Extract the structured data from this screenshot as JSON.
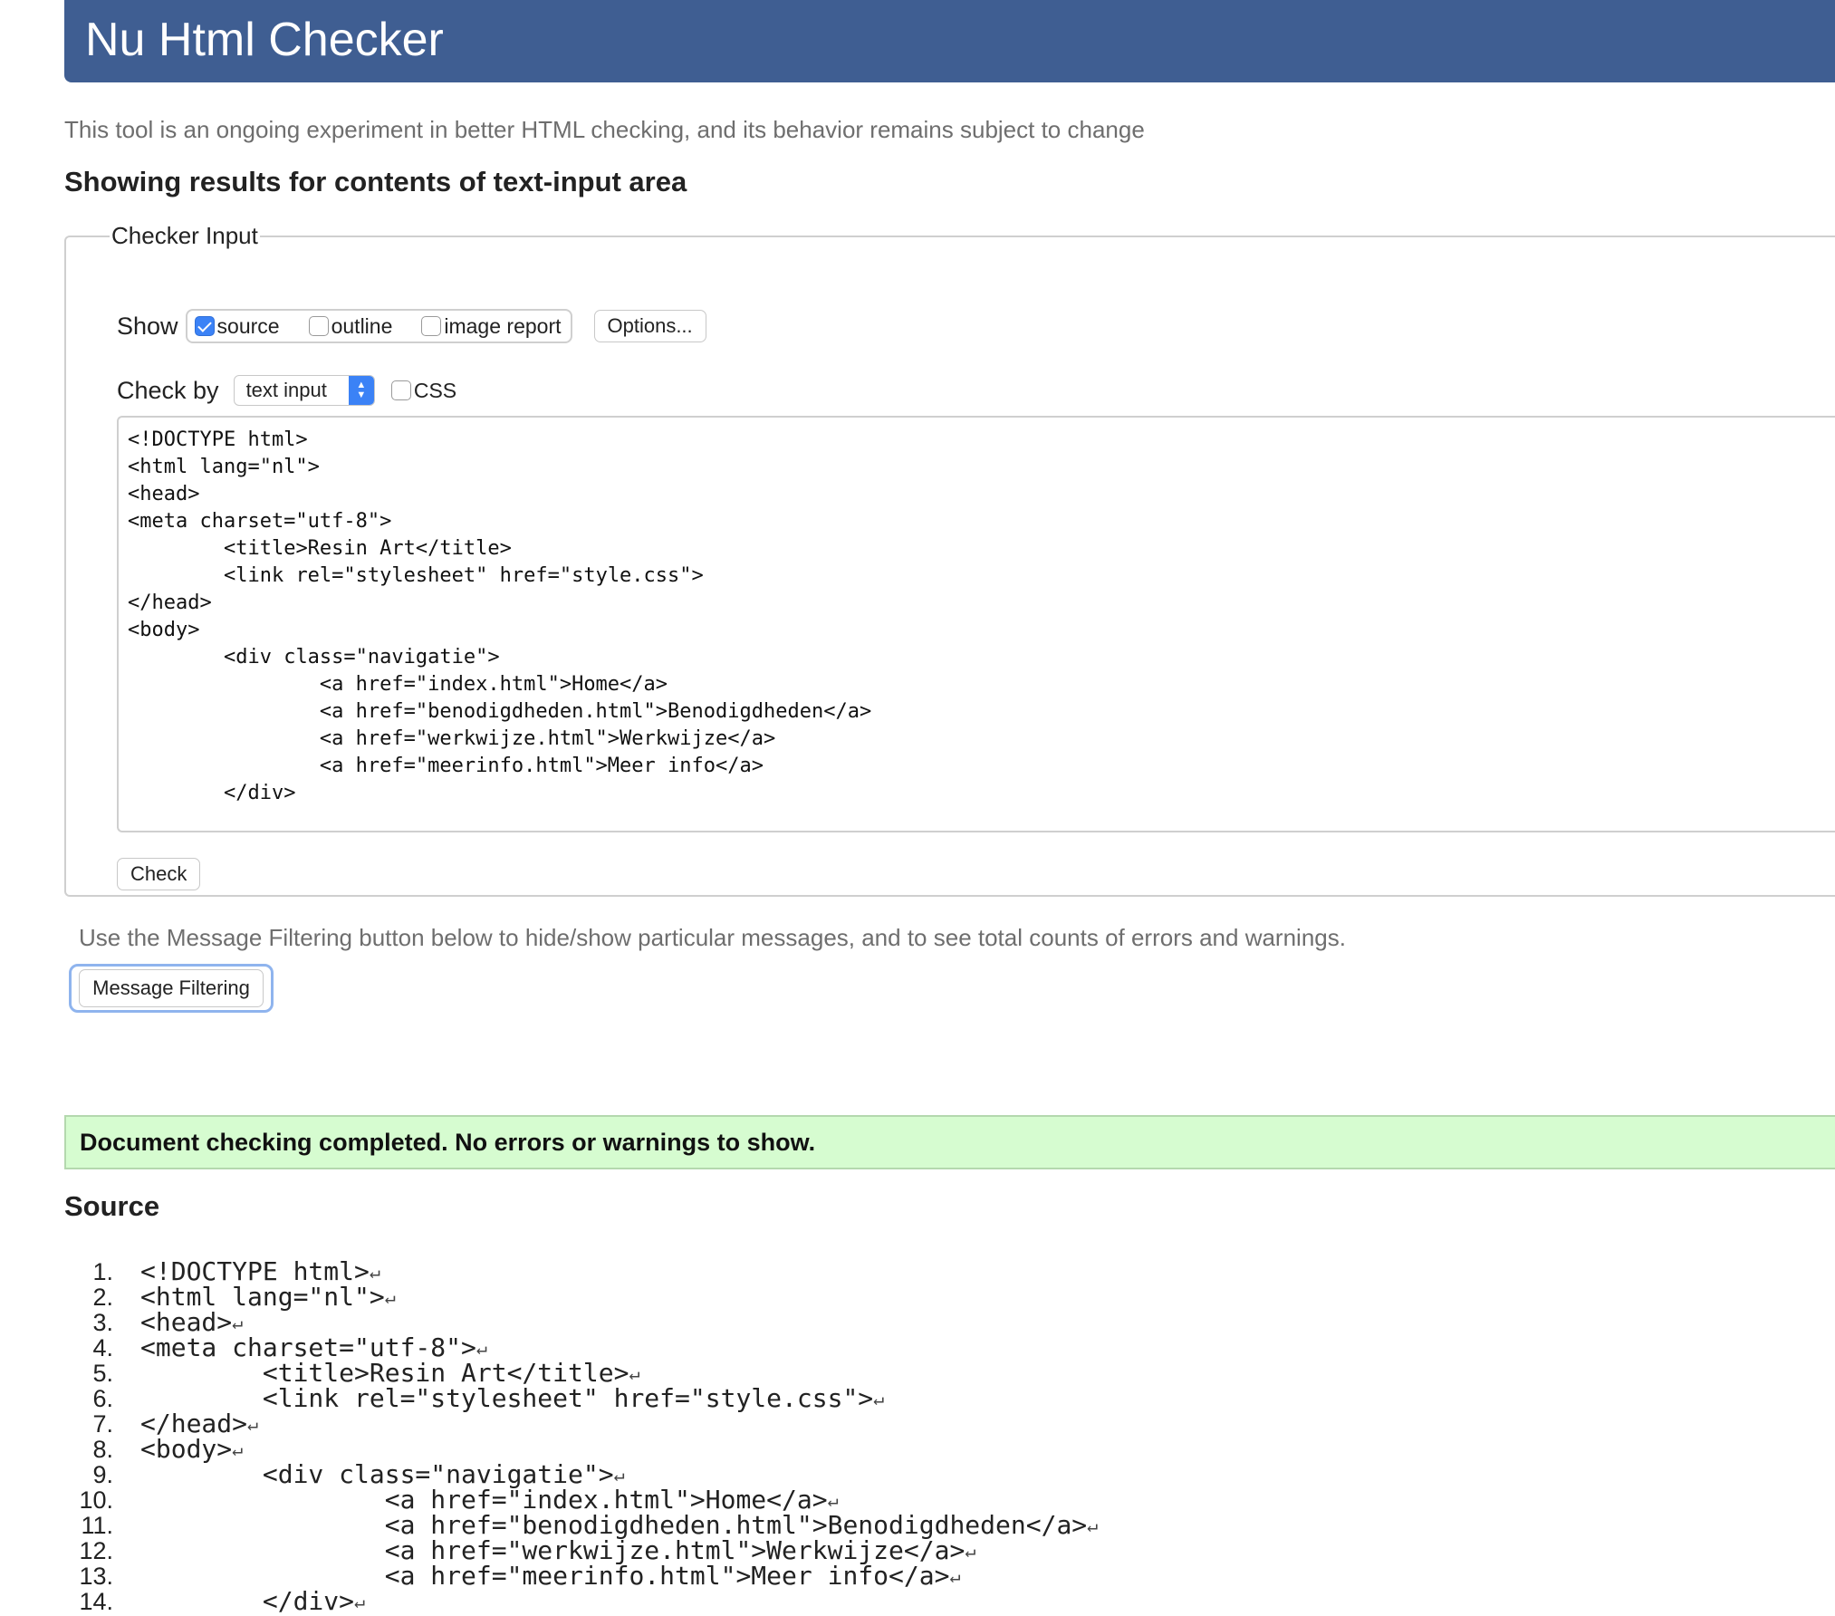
{
  "header": {
    "title": "Nu Html Checker"
  },
  "intro": "This tool is an ongoing experiment in better HTML checking, and its behavior remains subject to change",
  "results_heading": "Showing results for contents of text-input area",
  "checker_input": {
    "legend": "Checker Input",
    "show_label": "Show",
    "show_options": [
      {
        "label": "source",
        "checked": true
      },
      {
        "label": "outline",
        "checked": false
      },
      {
        "label": "image report",
        "checked": false
      }
    ],
    "options_button": "Options...",
    "check_by_label": "Check by",
    "check_by_value": "text input",
    "css_label": "CSS",
    "css_checked": false,
    "textarea_lines": [
      "<!DOCTYPE html>",
      "<html lang=\"nl\">",
      "<head>",
      "<meta charset=\"utf-8\">",
      "\t<title>Resin Art</title>",
      "\t<link rel=\"stylesheet\" href=\"style.css\">",
      "</head>",
      "<body>",
      "\t<div class=\"navigatie\">",
      "\t\t<a href=\"index.html\">Home</a>",
      "\t\t<a href=\"benodigdheden.html\">Benodigdheden</a>",
      "\t\t<a href=\"werkwijze.html\">Werkwijze</a>",
      "\t\t<a href=\"meerinfo.html\">Meer info</a>",
      "\t</div>"
    ],
    "check_button": "Check"
  },
  "filter_note": "Use the Message Filtering button below to hide/show particular messages, and to see total counts of errors and warnings.",
  "filter_button": "Message Filtering",
  "success_message": "Document checking completed. No errors or warnings to show.",
  "source_heading": "Source",
  "source_lines": [
    {
      "num": "1.",
      "code": "<!DOCTYPE html>"
    },
    {
      "num": "2.",
      "code": "<html lang=\"nl\">"
    },
    {
      "num": "3.",
      "code": "<head>"
    },
    {
      "num": "4.",
      "code": "<meta charset=\"utf-8\">"
    },
    {
      "num": "5.",
      "code": "\t<title>Resin Art</title>"
    },
    {
      "num": "6.",
      "code": "\t<link rel=\"stylesheet\" href=\"style.css\">"
    },
    {
      "num": "7.",
      "code": "</head>"
    },
    {
      "num": "8.",
      "code": "<body>"
    },
    {
      "num": "9.",
      "code": "\t<div class=\"navigatie\">"
    },
    {
      "num": "10.",
      "code": "\t\t<a href=\"index.html\">Home</a>"
    },
    {
      "num": "11.",
      "code": "\t\t<a href=\"benodigdheden.html\">Benodigdheden</a>"
    },
    {
      "num": "12.",
      "code": "\t\t<a href=\"werkwijze.html\">Werkwijze</a>"
    },
    {
      "num": "13.",
      "code": "\t\t<a href=\"meerinfo.html\">Meer info</a>"
    },
    {
      "num": "14.",
      "code": "\t</div>"
    }
  ],
  "line_end_glyph": "↵",
  "colors": {
    "banner": "#3f5e92",
    "success_bg": "#d6fcd0",
    "accent": "#3b82f6"
  }
}
